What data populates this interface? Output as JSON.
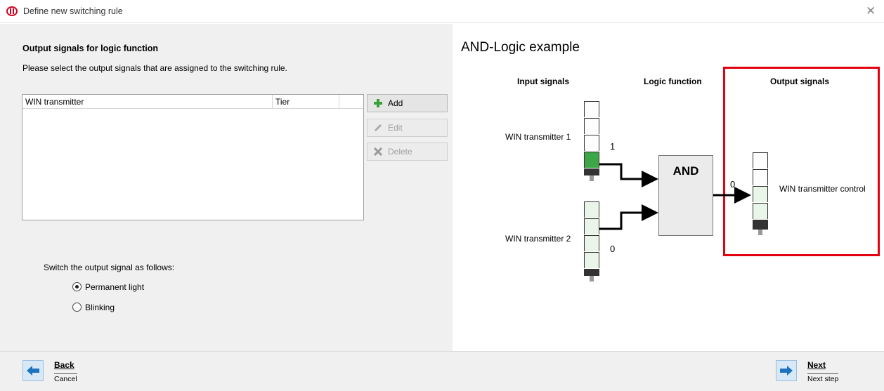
{
  "window": {
    "title": "Define new switching rule",
    "close_glyph": "✕"
  },
  "left": {
    "section_title": "Output signals for logic function",
    "section_desc": "Please select the output signals that are assigned to the switching rule.",
    "list": {
      "columns": [
        "WIN transmitter",
        "Tier",
        ""
      ],
      "rows": []
    },
    "buttons": {
      "add": "Add",
      "edit": "Edit",
      "delete": "Delete"
    },
    "switch_label": "Switch the output signal as follows:",
    "radio": {
      "permanent": "Permanent light",
      "blinking": "Blinking",
      "selected": "Permanent light"
    }
  },
  "right": {
    "example_title": "AND-Logic example",
    "headers": {
      "input": "Input signals",
      "logic": "Logic function",
      "output": "Output signals"
    },
    "transmitter_1": "WIN transmitter 1",
    "transmitter_2": "WIN transmitter 2",
    "value_1": "1",
    "value_2": "0",
    "and_label": "AND",
    "output_value": "0",
    "output_label": "WIN transmitter control"
  },
  "footer": {
    "back": "Back",
    "cancel": "Cancel",
    "next": "Next",
    "next_step": "Next step"
  },
  "colors": {
    "highlight": "#e3000f",
    "signal_on": "#3da647",
    "signal_off": "#e9f5e9",
    "nav_arrow": "#1e73be"
  },
  "icons": {
    "logo": "company-logo-icon",
    "add": "plus-icon",
    "edit": "pencil-icon",
    "delete": "delete-x-icon",
    "back": "arrow-left-icon",
    "next": "arrow-right-icon"
  }
}
